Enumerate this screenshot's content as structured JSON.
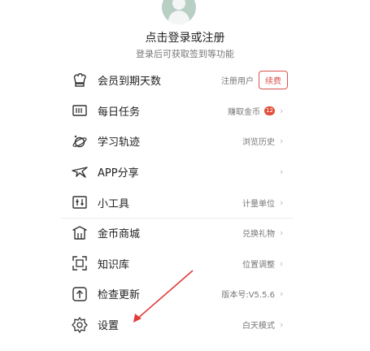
{
  "header": {
    "login_title": "点击登录或注册",
    "login_subtitle": "登录后可获取签到等功能"
  },
  "menu_group_1": [
    {
      "id": "membership",
      "icon": "chef-hat-icon",
      "label": "会员到期天数",
      "right": "注册用户",
      "button": "续费"
    },
    {
      "id": "daily-tasks",
      "icon": "task-list-icon",
      "label": "每日任务",
      "right": "赚取金币",
      "badge": "12"
    },
    {
      "id": "learning-track",
      "icon": "planet-icon",
      "label": "学习轨迹",
      "right": "浏览历史"
    },
    {
      "id": "app-share",
      "icon": "share-bird-icon",
      "label": "APP分享",
      "right": ""
    },
    {
      "id": "tools",
      "icon": "tools-icon",
      "label": "小工具",
      "right": "计量单位"
    }
  ],
  "menu_group_2": [
    {
      "id": "coin-mall",
      "icon": "mall-icon",
      "label": "金币商城",
      "right": "兑换礼物"
    },
    {
      "id": "knowledge",
      "icon": "knowledge-icon",
      "label": "知识库",
      "right": "位置调整"
    },
    {
      "id": "check-update",
      "icon": "update-icon",
      "label": "检查更新",
      "right": "版本号:V5.5.6"
    },
    {
      "id": "settings",
      "icon": "gear-icon",
      "label": "设置",
      "right": "白天模式"
    }
  ],
  "colors": {
    "accent": "#d9534f",
    "annotation_arrow": "#e23b3b"
  }
}
